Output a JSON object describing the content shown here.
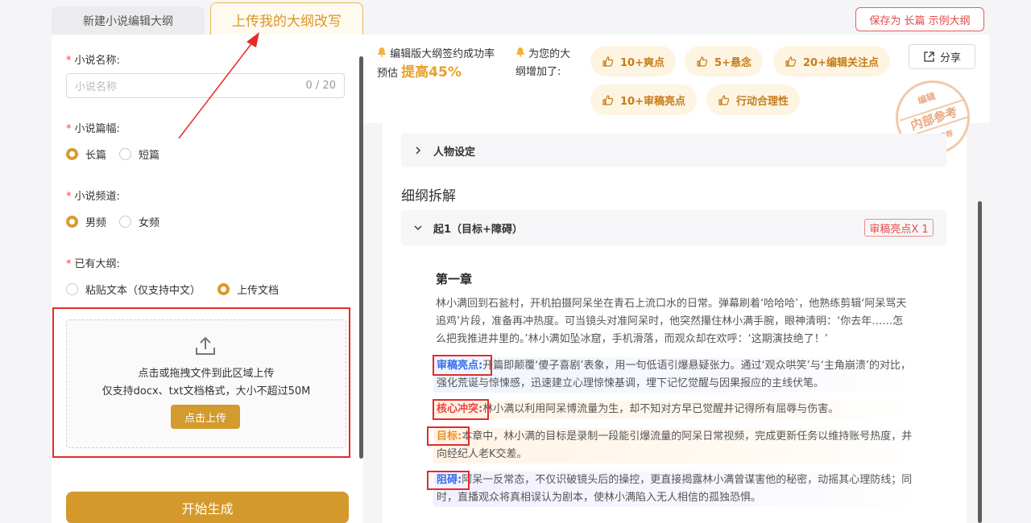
{
  "tabs": {
    "new_outline": "新建小说编辑大纲",
    "upload_rewrite": "上传我的大纲改写"
  },
  "form": {
    "name_label": "小说名称:",
    "name_placeholder": "小说名称",
    "name_count": "0 / 20",
    "length_label": "小说篇幅:",
    "length_options": [
      "长篇",
      "短篇"
    ],
    "length_selected": "长篇",
    "channel_label": "小说频道:",
    "channel_options": [
      "男频",
      "女频"
    ],
    "channel_selected": "男频",
    "outline_label": "已有大纲:",
    "outline_options": [
      "粘贴文本（仅支持中文）",
      "上传文档"
    ],
    "outline_selected": "上传文档",
    "upload_line1": "点击或拖拽文件到此区域上传",
    "upload_line2": "仅支持docx、txt文档格式，大小不超过50M",
    "upload_button": "点击上传",
    "generate_button": "开始生成"
  },
  "header": {
    "save_button": "保存为 长篇 示例大纲",
    "share_button": "分享",
    "stat1_line1": "编辑版大纲签约成功率",
    "stat1_prefix": "预估",
    "stat1_value": "提高45%",
    "stat2_line1": "为您的大",
    "stat2_line2": "纲增加了:",
    "tags": [
      "10+爽点",
      "5+悬念",
      "20+编辑关注点",
      "10+审稿亮点",
      "行动合理性"
    ],
    "stamp_top": "编辑",
    "stamp_mid": "内部参考",
    "stamp_bottom": "本月推荐"
  },
  "content": {
    "character_section": "人物设定",
    "breakdown_title": "细纲拆解",
    "segment_title": "起1（目标+障碍）",
    "segment_badge": "审稿亮点X 1",
    "chapter_title": "第一章",
    "chapter_text": "林小满回到石瓮村，开机拍摄阿呆坐在青石上流口水的日常。弹幕刷着‘哈哈哈’，他熟练剪辑‘阿呆骂天追鸡’片段，准备再冲热度。可当镜头对准阿呆时，他突然攥住林小满手腕，眼神清明：‘你去年……怎么把我推进井里的。’林小满如坠冰窟，手机滑落，而观众却在欢呼：‘这期演技绝了！’",
    "highlight_label": "审稿亮点:",
    "highlight_text": "开篇即颠覆‘傻子喜剧’表象，用一句低语引爆悬疑张力。通过‘观众哄笑’与‘主角崩溃’的对比，强化荒诞与惊悚感，迅速建立心理惊悚基调，埋下记忆觉醒与因果报应的主线伏笔。",
    "conflict_label": "核心冲突:",
    "conflict_text": "林小满以利用阿呆博流量为生，却不知对方早已觉醒并记得所有屈辱与伤害。",
    "goal_label": "目标:",
    "goal_text": "本章中，林小满的目标是录制一段能引爆流量的阿呆日常视频，完成更新任务以维持账号热度，并向经纪人老K交差。",
    "obstacle_label": "阻碍:",
    "obstacle_text": "阿呆一反常态，不仅识破镜头后的操控，更直接揭露林小满曾谋害他的秘密，动摇其心理防线；同时，直播观众将真相误认为剧本，使林小满陷入无人相信的孤独恐惧。"
  }
}
